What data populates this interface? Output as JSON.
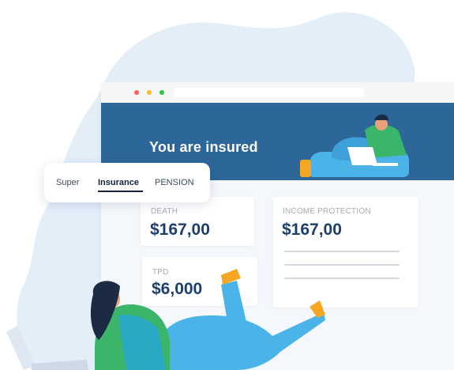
{
  "browser": {
    "hero_title": "You are insured"
  },
  "tabs": [
    {
      "label": "Super",
      "active": false
    },
    {
      "label": "Insurance",
      "active": true
    },
    {
      "label": "PENSION",
      "active": false
    }
  ],
  "cards": {
    "death": {
      "label": "DEATH",
      "value": "$167,00"
    },
    "tpd": {
      "label": "TPD",
      "value": "$6,000"
    },
    "income_protection": {
      "label": "INCOME PROTECTION",
      "value": "$167,00"
    }
  },
  "colors": {
    "hero": "#2d6699",
    "value_text": "#1d3f6c",
    "blob": "#e3eef9"
  }
}
